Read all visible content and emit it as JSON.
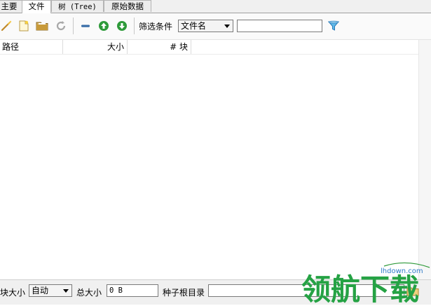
{
  "tabs": [
    {
      "label": "主要"
    },
    {
      "label": "文件"
    },
    {
      "label": "树 (Tree)"
    },
    {
      "label": "原始数据"
    }
  ],
  "toolbar": {
    "filter_label": "筛选条件",
    "filter_field": "文件名",
    "filter_value": "",
    "icons": [
      "wand-icon",
      "new-file-icon",
      "folder-icon",
      "refresh-icon",
      "remove-icon",
      "move-up-icon",
      "move-down-icon",
      "filter-icon"
    ]
  },
  "table": {
    "columns": [
      "路径",
      "大小",
      "# 块"
    ],
    "rows": []
  },
  "bottom": {
    "piece_size_label": "块大小",
    "piece_size_value": "自动",
    "total_size_label": "总大小",
    "total_size_value": "0 B",
    "root_dir_label": "种子根目录",
    "root_dir_value": ""
  },
  "watermark": {
    "text": "领航下载",
    "url": "lhdown.com"
  },
  "colors": {
    "tab_bg": "#ececec",
    "active_tab_bg": "#ffffff",
    "arrow_green": "#2e9a3a",
    "remove_blue": "#3a6ea8",
    "filter_blue": "#3aa0dc",
    "watermark_green": "#25a244"
  }
}
